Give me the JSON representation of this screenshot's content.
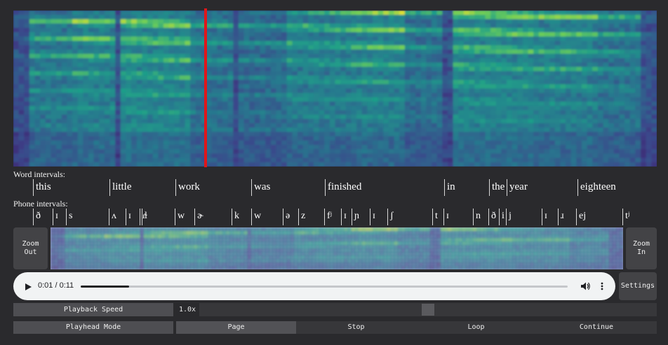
{
  "labels": {
    "word_intervals": "Word intervals:",
    "phone_intervals": "Phone intervals:"
  },
  "word_intervals": [
    "this",
    "little",
    "work",
    "was",
    "finished",
    "in",
    "the",
    "year",
    "eighteen"
  ],
  "phone_intervals": [
    "ð",
    "ɪ",
    "s",
    "ʌ",
    "ɪ",
    "ɾ",
    "ɫ",
    "w",
    "ɚ",
    "k",
    "w",
    "ə",
    "z",
    "fʲ",
    "ɪ",
    "ɲ",
    "ɪ",
    "ʃ",
    "t",
    "ɪ",
    "n",
    "ð",
    "i",
    "j",
    "ɪ",
    "ɹ",
    "ej",
    "tʲ"
  ],
  "overview": {
    "zoom_out_label": "Zoom Out",
    "zoom_in_label": "Zoom In"
  },
  "audio_player": {
    "current_time": "0:01",
    "duration": "0:11",
    "time_display": "0:01 / 0:11",
    "progress": 0.1,
    "play_icon": "play-icon",
    "volume_icon": "volume-icon",
    "menu_icon": "more-vert-icon"
  },
  "settings_label": "Settings",
  "playback_speed": {
    "label": "Playback Speed",
    "value": "1.0x",
    "slider_level": 0.5
  },
  "playhead_mode": {
    "label": "Playhead Mode",
    "options": [
      "Page",
      "Stop",
      "Loop",
      "Continue"
    ],
    "selected": "Page"
  },
  "colors": {
    "background": "#2a2a2d",
    "playhead": "#e0161a",
    "spectrogram_low": "#2f2a66",
    "spectrogram_mid": "#26908c",
    "spectrogram_high": "#e4e33a",
    "button": "#434346"
  }
}
